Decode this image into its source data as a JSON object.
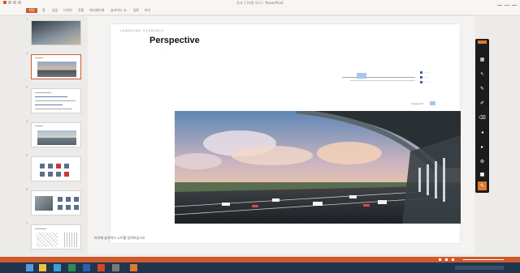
{
  "titlebar": {
    "title": "문서 1 [호환 모드] - PowerPoint"
  },
  "ribbon": {
    "tabs": [
      "파일",
      "홈",
      "삽입",
      "디자인",
      "전환",
      "애니메이션",
      "슬라이드 쇼",
      "검토",
      "보기"
    ]
  },
  "slides": [
    {
      "num": "1",
      "kind": "dark"
    },
    {
      "num": "2",
      "kind": "photo",
      "selected": true
    },
    {
      "num": "3",
      "kind": "diagram"
    },
    {
      "num": "4",
      "kind": "photo2"
    },
    {
      "num": "5",
      "kind": "grid"
    },
    {
      "num": "6",
      "kind": "grid2"
    },
    {
      "num": "7",
      "kind": "sketch"
    }
  ],
  "slide": {
    "kicker": "LANDSIDE SCENARIO",
    "title": "Perspective",
    "tag": "Viewpoint"
  },
  "notes": {
    "text": "여기에 슬라이드 노트를 입력하십시오"
  },
  "pen_tools": [
    "exit-icon",
    "slides-icon",
    "pointer-icon",
    "pen-icon",
    "highlighter-icon",
    "eraser-icon",
    "prev-icon",
    "next-icon",
    "options-icon",
    "end-icon",
    "ink-icon"
  ],
  "colors": {
    "accent": "#cf5a2c",
    "taskbar": "#20364e"
  }
}
